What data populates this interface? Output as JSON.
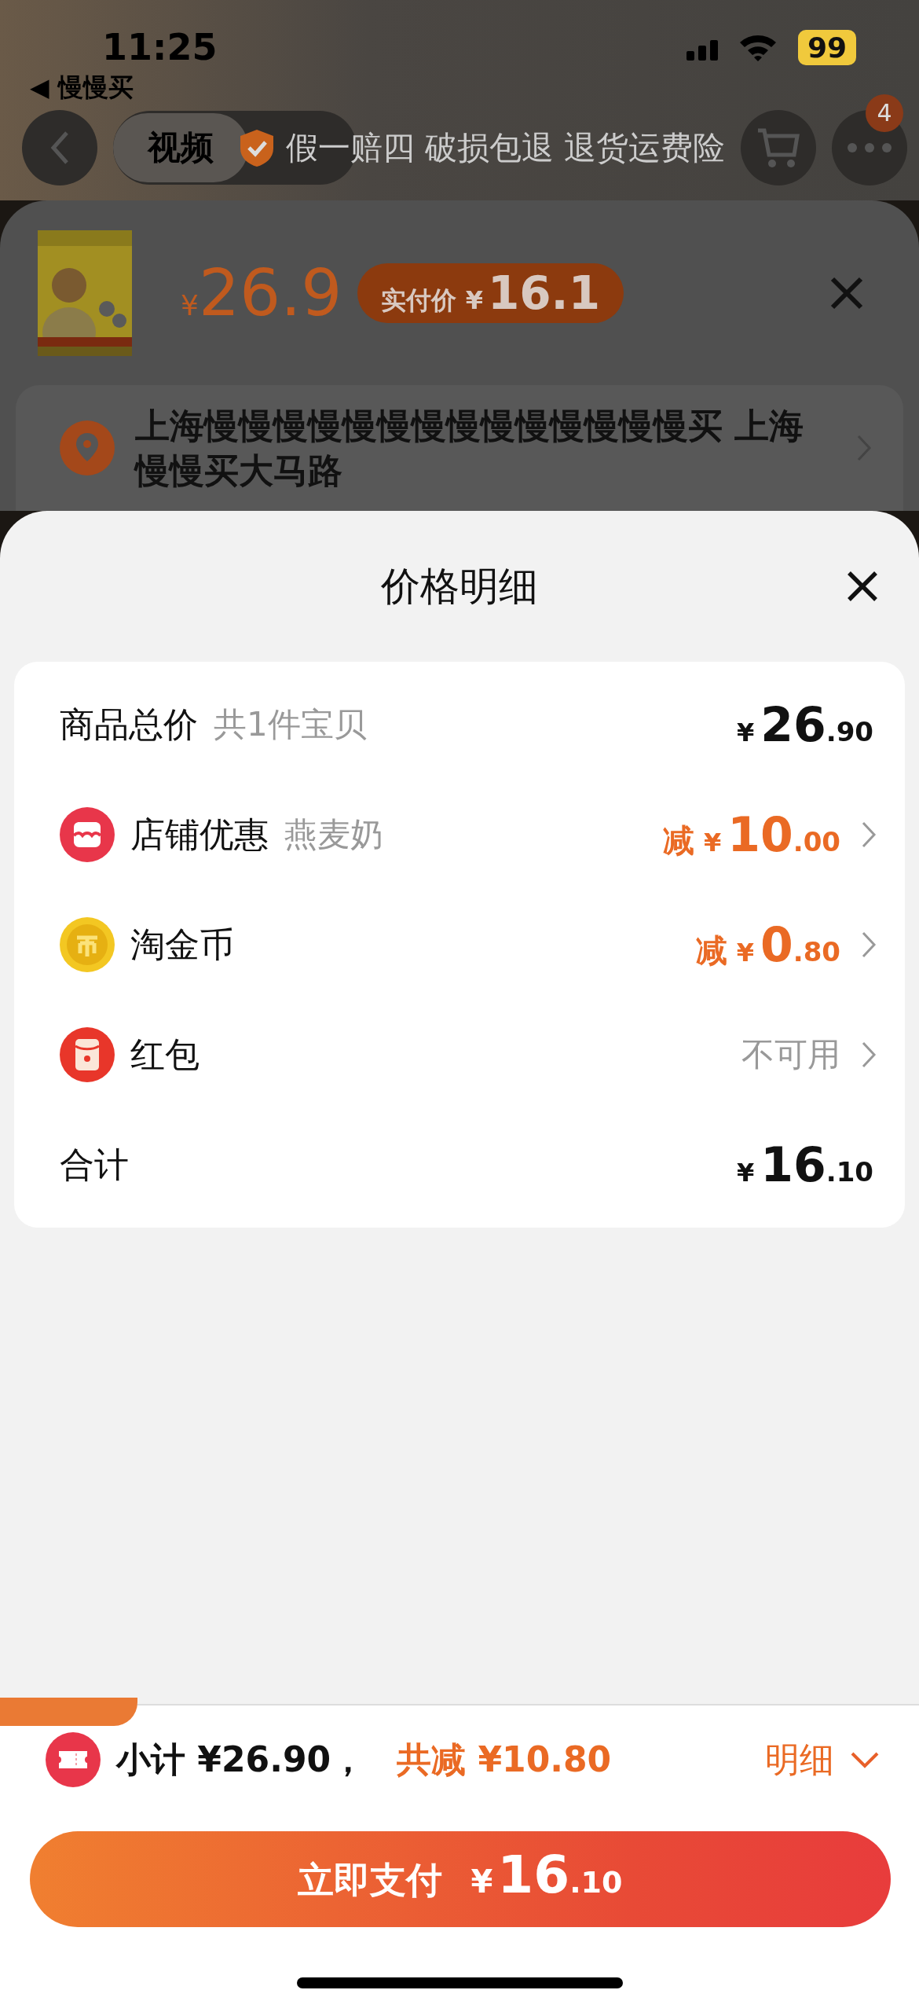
{
  "status_bar": {
    "time": "11:25",
    "back_app": "◀ 慢慢买",
    "battery": "99"
  },
  "nav": {
    "tabs": [
      {
        "label": "视频",
        "selected": true
      }
    ],
    "banner": "假一赔四 破损包退 退货运费险",
    "badge": "4"
  },
  "product": {
    "price_currency": "¥",
    "price": "26.9",
    "paid_label": "实付价",
    "paid_currency": "¥",
    "paid_price": "16.1"
  },
  "address": {
    "text": "上海慢慢慢慢慢慢慢慢慢慢慢慢慢慢买 上海慢慢买大马路"
  },
  "sheet": {
    "title": "价格明细"
  },
  "rows": [
    {
      "kind": "amount",
      "label": "商品总价",
      "note": "共1件宝贝",
      "currency": "¥",
      "int": "26",
      "dec": ".90",
      "chevron": false
    },
    {
      "kind": "discount",
      "label": "店铺优惠",
      "note": "燕麦奶",
      "prefix": "减",
      "currency": "¥",
      "int": "10",
      "dec": ".00",
      "chevron": true
    },
    {
      "kind": "discount",
      "label": "淘金币",
      "prefix": "减",
      "currency": "¥",
      "int": "0",
      "dec": ".80",
      "chevron": true
    },
    {
      "kind": "status",
      "label": "红包",
      "status": "不可用",
      "chevron": true
    },
    {
      "kind": "amount",
      "label": "合计",
      "currency": "¥",
      "int": "16",
      "dec": ".10",
      "chevron": false
    }
  ],
  "footer": {
    "subtotal": "小计 ¥26.90，",
    "saved": "共减 ¥10.80",
    "detail": "明细"
  },
  "pay_button": {
    "label": "立即支付",
    "currency": "¥",
    "int": "16",
    "dec": ".10"
  }
}
